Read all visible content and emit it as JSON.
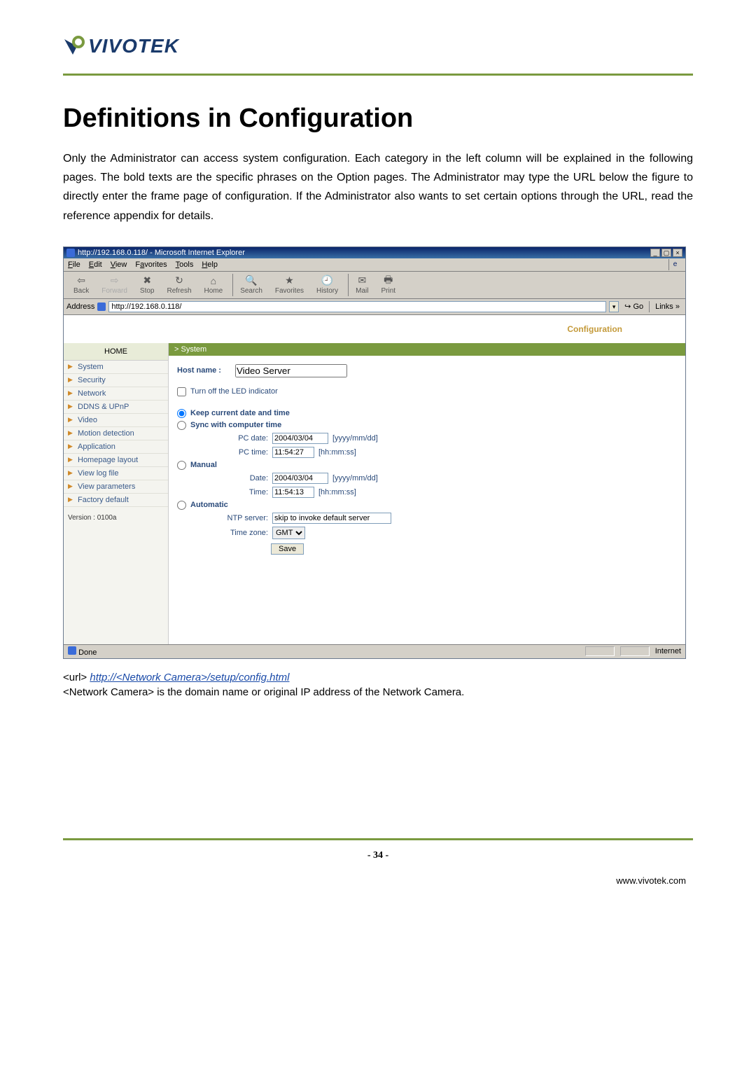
{
  "brand": {
    "name": "VIVOTEK",
    "site": "www.vivotek.com"
  },
  "title": "Definitions in Configuration",
  "intro": "Only the Administrator can access system configuration. Each category in the left column will be explained in the following pages. The bold texts are the specific phrases on the Option pages. The Administrator may type the URL below the figure to directly enter the frame page of configuration. If the Administrator also wants to set certain options through the URL, read the reference appendix for details.",
  "browser": {
    "title": "http://192.168.0.118/ - Microsoft Internet Explorer",
    "menus": [
      "File",
      "Edit",
      "View",
      "Favorites",
      "Tools",
      "Help"
    ],
    "toolbar": {
      "back": "Back",
      "forward": "Forward",
      "stop": "Stop",
      "refresh": "Refresh",
      "home": "Home",
      "search": "Search",
      "favorites": "Favorites",
      "history": "History",
      "mail": "Mail",
      "print": "Print"
    },
    "address_label": "Address",
    "address_value": "http://192.168.0.118/",
    "go": "Go",
    "links": "Links",
    "status_left": "Done",
    "status_right": "Internet"
  },
  "config": {
    "header_label": "Configuration",
    "home": "HOME",
    "nav": [
      "System",
      "Security",
      "Network",
      "DDNS & UPnP",
      "Video",
      "Motion detection",
      "Application",
      "Homepage layout",
      "View log file",
      "View parameters",
      "Factory default"
    ],
    "version": "Version : 0100a",
    "section": "> System",
    "hostname_label": "Host name :",
    "hostname_value": "Video Server",
    "led_label": "Turn off the LED indicator",
    "radio_keep": "Keep current date and time",
    "radio_sync": "Sync with computer time",
    "pc_date_label": "PC date:",
    "pc_date_value": "2004/03/04",
    "pc_date_hint": "[yyyy/mm/dd]",
    "pc_time_label": "PC time:",
    "pc_time_value": "11:54:27",
    "pc_time_hint": "[hh:mm:ss]",
    "radio_manual": "Manual",
    "date_label": "Date:",
    "date_value": "2004/03/04",
    "date_hint": "[yyyy/mm/dd]",
    "time_label": "Time:",
    "time_value": "11:54:13",
    "time_hint": "[hh:mm:ss]",
    "radio_auto": "Automatic",
    "ntp_label": "NTP server:",
    "ntp_value": "skip to invoke default server",
    "tz_label": "Time zone:",
    "tz_value": "GMT",
    "save": "Save"
  },
  "url_line_prefix": "<url> ",
  "url_link": "http://<Network Camera>/setup/config.html",
  "note": "<Network Camera> is the domain name or original IP address of the Network Camera.",
  "page_number": "- 34 -"
}
